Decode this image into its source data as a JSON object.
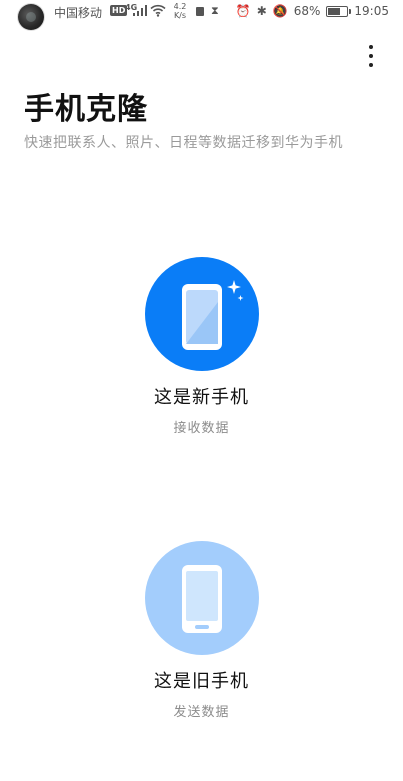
{
  "status_bar": {
    "carrier": "中国移动",
    "hd": "HD",
    "network": "4G",
    "speed_value": "4.2",
    "speed_unit": "K/s",
    "hourglass": "⧗",
    "alarm": "⏰",
    "bluetooth": "✱",
    "mute": "🔕",
    "battery_percent": "68%",
    "battery_level": 68,
    "time": "19:05"
  },
  "header": {
    "title": "手机克隆",
    "subtitle": "快速把联系人、照片、日程等数据迁移到华为手机"
  },
  "options": [
    {
      "title": "这是新手机",
      "subtitle": "接收数据",
      "icon": "new-phone-icon"
    },
    {
      "title": "这是旧手机",
      "subtitle": "发送数据",
      "icon": "old-phone-icon"
    }
  ],
  "colors": {
    "accent": "#0A7DF7",
    "accent_light": "#A3CDFC"
  }
}
